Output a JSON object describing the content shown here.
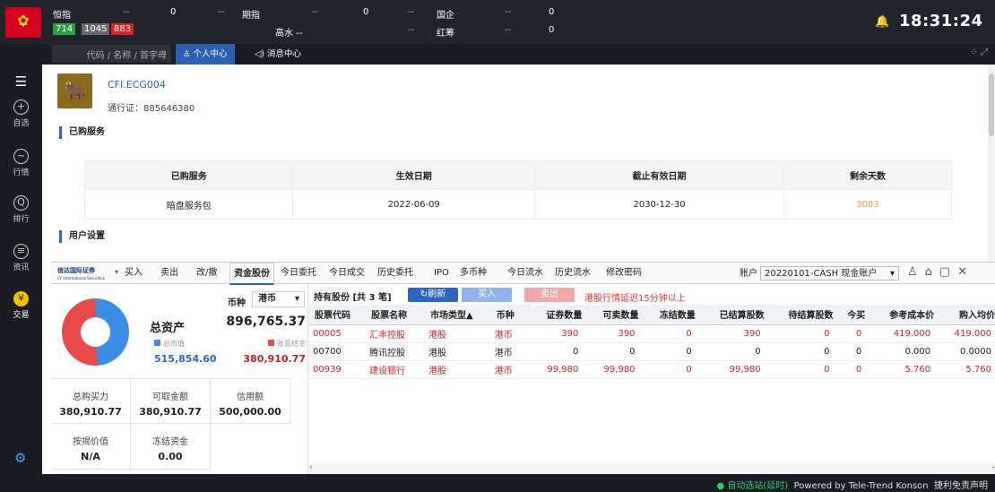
{
  "ticker": {
    "hsi_label": "恒指",
    "hsi_dash": "--",
    "hsi_a": "714",
    "hsi_b": "1045",
    "hsi_c": "883",
    "v1": "0",
    "d1": "--",
    "fut_label": "期指",
    "fut_dash": "--",
    "v2": "0",
    "d2": "--",
    "gao": "高水 --",
    "gq_label": "国企",
    "gq_dash": "--",
    "v3": "0",
    "hc_label": "红筹",
    "hc_dash": "--",
    "v4": "0",
    "d3": "--",
    "d4": "--"
  },
  "clock": "18:31:24",
  "nav": {
    "search_placeholder": "代码 / 名称 / 首字母",
    "personal": "个人中心",
    "news": "消息中心"
  },
  "sidebar": [
    {
      "label": "自选",
      "icon": "+"
    },
    {
      "label": "行情",
      "icon": "~"
    },
    {
      "label": "排行",
      "icon": "Q"
    },
    {
      "label": "资讯",
      "icon": "≡"
    },
    {
      "label": "交易",
      "icon": "¥"
    }
  ],
  "user": {
    "name": "CFI.ECG004",
    "pass": "通行证：885646380"
  },
  "sections": {
    "bought": "已购服务",
    "settings": "用户设置"
  },
  "services": {
    "headers": [
      "已购服务",
      "生效日期",
      "截止有效日期",
      "剩余天数"
    ],
    "rows": [
      [
        "暗盘服务包",
        "2022-06-09",
        "2030-12-30",
        "3083"
      ]
    ]
  },
  "trade": {
    "broker": "信达国际证券",
    "broker_sub": "CF International Securities",
    "tabs": [
      "买入",
      "卖出",
      "改/撤",
      "资金股份",
      "今日委托",
      "今日成交",
      "历史委托",
      "IPO",
      "多币种",
      "今日流水",
      "历史流水",
      "修改密码"
    ],
    "account_label": "账户",
    "account": "20220101-CASH 现金账户"
  },
  "funds": {
    "currency_label": "币种",
    "currency": "港币",
    "total_label": "总资产",
    "total": "896,765.37",
    "mv_label": "总市值",
    "mv": "515,854.60",
    "cash_label": "账面结余",
    "cash": "380,910.77",
    "cells": [
      [
        "总购买力",
        "380,910.77"
      ],
      [
        "可取金额",
        "380,910.77"
      ],
      [
        "信用额",
        "500,000.00"
      ],
      [
        "按揭价值",
        "N/A"
      ],
      [
        "冻结资金",
        "0.00"
      ]
    ],
    "donut": {
      "market_value_pct": 57.5,
      "cash_pct": 42.5
    }
  },
  "holdings": {
    "title": "持有股份 [共 3 笔]",
    "refresh": "刷新",
    "buy": "买入",
    "sell": "卖出",
    "delay": "港股行情延迟15分钟以上",
    "headers": [
      "股票代码",
      "股票名称",
      "市场类型▲",
      "币种",
      "证券数量",
      "可卖数量",
      "冻结数量",
      "已结算股数",
      "待结算股数",
      "今买",
      "参考成本价",
      "购入均价"
    ],
    "rows": [
      {
        "up": true,
        "cells": [
          "00005",
          "汇丰控股",
          "港股",
          "港币",
          "390",
          "390",
          "0",
          "390",
          "0",
          "0",
          "419.000",
          "419.000"
        ]
      },
      {
        "up": false,
        "cells": [
          "00700",
          "腾讯控股",
          "港股",
          "港币",
          "0",
          "0",
          "0",
          "0",
          "0",
          "0",
          "0.000",
          "0.0000"
        ]
      },
      {
        "up": true,
        "cells": [
          "00939",
          "建设银行",
          "港股",
          "港币",
          "99,980",
          "99,980",
          "0",
          "99,980",
          "0",
          "0",
          "5.760",
          "5.760"
        ]
      }
    ]
  },
  "footer": {
    "auto": "● 自动选站(延时)",
    "powered": "Powered by Tele-Trend Konson",
    "disclaimer": "捷利免责声明"
  }
}
